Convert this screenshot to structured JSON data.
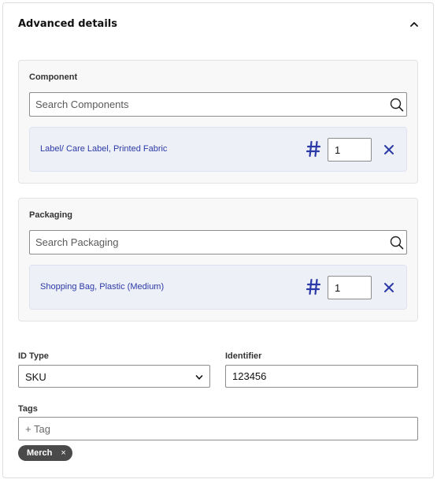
{
  "header": {
    "title": "Advanced details",
    "collapse_icon": "chevron-up-icon"
  },
  "component": {
    "label": "Component",
    "search_placeholder": "Search Components",
    "items": [
      {
        "name": "Label/ Care Label, Printed Fabric",
        "quantity": "1"
      }
    ]
  },
  "packaging": {
    "label": "Packaging",
    "search_placeholder": "Search Packaging",
    "items": [
      {
        "name": "Shopping Bag, Plastic (Medium)",
        "quantity": "1"
      }
    ]
  },
  "id_type": {
    "label": "ID Type",
    "value": "SKU"
  },
  "identifier": {
    "label": "Identifier",
    "value": "123456"
  },
  "tags": {
    "label": "Tags",
    "placeholder": "+ Tag",
    "chips": [
      {
        "label": "Merch",
        "remove_glyph": "×"
      }
    ]
  },
  "colors": {
    "accent": "#2b3aa6",
    "chip_bg": "#4a4a4a",
    "item_bg": "#eef0f8"
  }
}
